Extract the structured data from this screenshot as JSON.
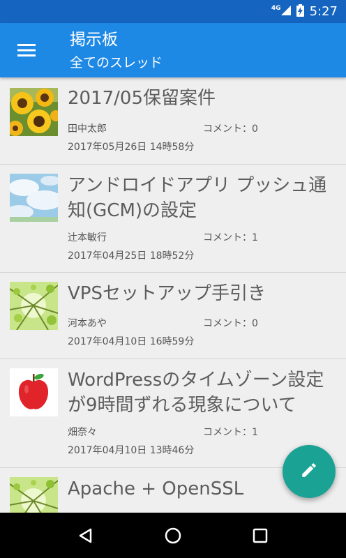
{
  "status_bar": {
    "network": "4G",
    "time": "5:27"
  },
  "app_bar": {
    "title": "掲示板",
    "subtitle": "全てのスレッド",
    "menu_icon": "hamburger-menu-icon"
  },
  "threads": [
    {
      "title": "2017/05保留案件",
      "author": "田中太郎",
      "comments": "コメント：0",
      "date": "2017年05月26日 14時58分",
      "thumbnail": "sunflower"
    },
    {
      "title": "アンドロイドアプリ プッシュ通知(GCM)の設定",
      "author": "辻本敏行",
      "comments": "コメント：1",
      "date": "2017年04月25日 18時52分",
      "thumbnail": "sky"
    },
    {
      "title": "VPSセットアップ手引き",
      "author": "河本あや",
      "comments": "コメント：0",
      "date": "2017年04月10日 16時59分",
      "thumbnail": "green-leaves"
    },
    {
      "title": "WordPressのタイムゾーン設定が9時間ずれる現象について",
      "author": "畑奈々",
      "comments": "コメント：1",
      "date": "2017年04月10日 13時46分",
      "thumbnail": "red-apple"
    },
    {
      "title": "Apache + OpenSSL",
      "thumbnail": "green-leaves"
    }
  ],
  "fab": {
    "icon": "pencil-icon"
  },
  "nav_bar": {
    "back_icon": "back-triangle-icon",
    "home_icon": "home-circle-icon",
    "recents_icon": "recents-square-icon"
  },
  "colors": {
    "status_bar": "#1565c0",
    "app_bar": "#1e88e5",
    "fab": "#1aa394",
    "background": "#efefef"
  }
}
